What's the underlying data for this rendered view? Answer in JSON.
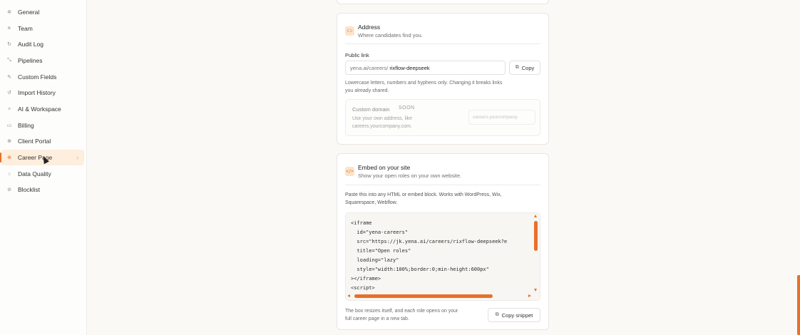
{
  "colors": {
    "accent": "#e8702a",
    "accent_soft": "#fdeedd"
  },
  "sidebar": {
    "items": [
      {
        "label": "General",
        "icon": "gear-icon"
      },
      {
        "label": "Team",
        "icon": "users-icon"
      },
      {
        "label": "Audit Log",
        "icon": "history-icon"
      },
      {
        "label": "Pipelines",
        "icon": "pipeline-icon"
      },
      {
        "label": "Custom Fields",
        "icon": "field-icon"
      },
      {
        "label": "Import History",
        "icon": "import-icon"
      },
      {
        "label": "AI & Workspace",
        "icon": "sparkle-icon"
      },
      {
        "label": "Billing",
        "icon": "card-icon"
      },
      {
        "label": "Client Portal",
        "icon": "globe-icon"
      },
      {
        "label": "Career Page",
        "icon": "globe-icon",
        "active": true
      },
      {
        "label": "Data Quality",
        "icon": "circle-icon"
      },
      {
        "label": "Blocklist",
        "icon": "ban-icon"
      }
    ]
  },
  "address": {
    "title": "Address",
    "subtitle": "Where candidates find you.",
    "public_link_label": "Public link",
    "url_prefix": "yena.ai/careers/",
    "url_value": "rixflow-deepseek",
    "copy_label": "Copy",
    "help_line1": "Lowercase letters, numbers and hyphens only. Changing it breaks links",
    "help_line2": "you already shared.",
    "custom_domain": {
      "title": "Custom domain",
      "badge": "SOON",
      "desc_line1": "Use your own address, like",
      "desc_line2": "careers.yourcompany.com.",
      "placeholder": "careers.yourcompany."
    }
  },
  "embed": {
    "title": "Embed on your site",
    "subtitle": "Show your open roles on your own website.",
    "intro_line1": "Paste this into any HTML or embed block. Works with WordPress, Wix,",
    "intro_line2": "Squarespace, Webflow.",
    "code": [
      "<iframe",
      "  id=\"yena-careers\"",
      "  src=\"https://jk.yena.ai/careers/rixflow-deepseek?e",
      "  title=\"Open roles\"",
      "  loading=\"lazy\"",
      "  style=\"width:100%;border:0;min-height:600px\"",
      "></iframe>",
      "<script>"
    ],
    "footer_line1": "The box resizes itself, and each role opens on your",
    "footer_line2": "full career page in a new tab.",
    "copy_snippet_label": "Copy snippet"
  }
}
